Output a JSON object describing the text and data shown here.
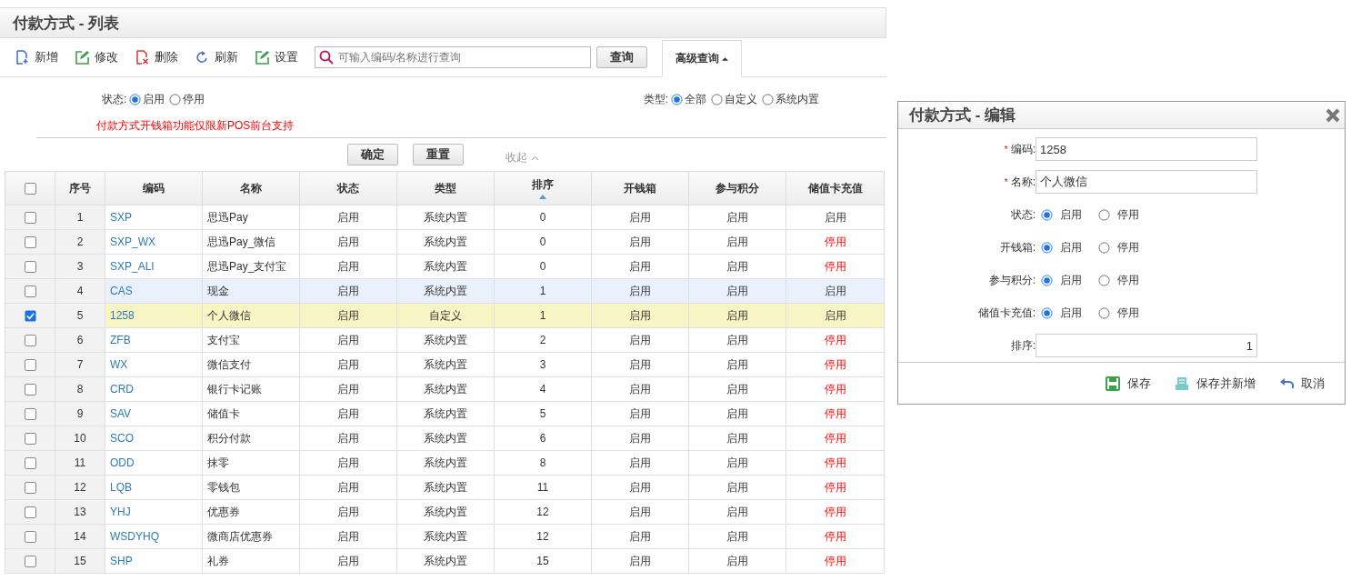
{
  "page": {
    "title": "付款方式 - 列表"
  },
  "toolbar": [
    {
      "kind": "add",
      "label": "新增"
    },
    {
      "kind": "edit",
      "label": "修改"
    },
    {
      "kind": "delete",
      "label": "删除"
    },
    {
      "kind": "refresh",
      "label": "刷新"
    },
    {
      "kind": "settings",
      "label": "设置"
    }
  ],
  "search": {
    "placeholder": "可输入编码/名称进行查询",
    "button": "查询",
    "advanced": "高级查询",
    "advanced_expanded": true
  },
  "filters": {
    "status": {
      "label": "状态:",
      "options": [
        {
          "label": "启用",
          "selected": true
        },
        {
          "label": "停用",
          "selected": false
        }
      ]
    },
    "type": {
      "label": "类型:",
      "options": [
        {
          "label": "全部",
          "selected": true
        },
        {
          "label": "自定义",
          "selected": false
        },
        {
          "label": "系统内置",
          "selected": false
        }
      ]
    },
    "notice": "付款方式开钱箱功能仅限新POS前台支持",
    "confirm": "确定",
    "reset": "重置",
    "collapse": "收起"
  },
  "table": {
    "all_checked": false,
    "columns": [
      {
        "label": "序号"
      },
      {
        "label": "编码"
      },
      {
        "label": "名称"
      },
      {
        "label": "状态"
      },
      {
        "label": "类型"
      },
      {
        "label": "排序",
        "sorted_ascending": true
      },
      {
        "label": "开钱箱"
      },
      {
        "label": "参与积分"
      },
      {
        "label": "储值卡充值"
      }
    ],
    "rows": [
      {
        "checked": false,
        "hovered": false,
        "no": "1",
        "code": "SXP",
        "name": "思迅Pay",
        "status": "启用",
        "type": "系统内置",
        "order": "0",
        "drawer": "启用",
        "points": "启用",
        "recharge": "启用",
        "recharge_on": true
      },
      {
        "checked": false,
        "hovered": false,
        "no": "2",
        "code": "SXP_WX",
        "name": "思迅Pay_微信",
        "status": "启用",
        "type": "系统内置",
        "order": "0",
        "drawer": "启用",
        "points": "启用",
        "recharge": "停用",
        "recharge_on": false
      },
      {
        "checked": false,
        "hovered": false,
        "no": "3",
        "code": "SXP_ALI",
        "name": "思迅Pay_支付宝",
        "status": "启用",
        "type": "系统内置",
        "order": "0",
        "drawer": "启用",
        "points": "启用",
        "recharge": "停用",
        "recharge_on": false
      },
      {
        "checked": false,
        "hovered": true,
        "no": "4",
        "code": "CAS",
        "name": "现金",
        "status": "启用",
        "type": "系统内置",
        "order": "1",
        "drawer": "启用",
        "points": "启用",
        "recharge": "启用",
        "recharge_on": true
      },
      {
        "checked": true,
        "hovered": false,
        "no": "5",
        "code": "1258",
        "name": "个人微信",
        "status": "启用",
        "type": "自定义",
        "order": "1",
        "drawer": "启用",
        "points": "启用",
        "recharge": "启用",
        "recharge_on": true
      },
      {
        "checked": false,
        "hovered": false,
        "no": "6",
        "code": "ZFB",
        "name": "支付宝",
        "status": "启用",
        "type": "系统内置",
        "order": "2",
        "drawer": "启用",
        "points": "启用",
        "recharge": "停用",
        "recharge_on": false
      },
      {
        "checked": false,
        "hovered": false,
        "no": "7",
        "code": "WX",
        "name": "微信支付",
        "status": "启用",
        "type": "系统内置",
        "order": "3",
        "drawer": "启用",
        "points": "启用",
        "recharge": "停用",
        "recharge_on": false
      },
      {
        "checked": false,
        "hovered": false,
        "no": "8",
        "code": "CRD",
        "name": "银行卡记账",
        "status": "启用",
        "type": "系统内置",
        "order": "4",
        "drawer": "启用",
        "points": "启用",
        "recharge": "停用",
        "recharge_on": false
      },
      {
        "checked": false,
        "hovered": false,
        "no": "9",
        "code": "SAV",
        "name": "储值卡",
        "status": "启用",
        "type": "系统内置",
        "order": "5",
        "drawer": "启用",
        "points": "启用",
        "recharge": "停用",
        "recharge_on": false
      },
      {
        "checked": false,
        "hovered": false,
        "no": "10",
        "code": "SCO",
        "name": "积分付款",
        "status": "启用",
        "type": "系统内置",
        "order": "6",
        "drawer": "启用",
        "points": "启用",
        "recharge": "停用",
        "recharge_on": false
      },
      {
        "checked": false,
        "hovered": false,
        "no": "11",
        "code": "ODD",
        "name": "抹零",
        "status": "启用",
        "type": "系统内置",
        "order": "8",
        "drawer": "启用",
        "points": "启用",
        "recharge": "停用",
        "recharge_on": false
      },
      {
        "checked": false,
        "hovered": false,
        "no": "12",
        "code": "LQB",
        "name": "零钱包",
        "status": "启用",
        "type": "系统内置",
        "order": "11",
        "drawer": "启用",
        "points": "启用",
        "recharge": "停用",
        "recharge_on": false
      },
      {
        "checked": false,
        "hovered": false,
        "no": "13",
        "code": "YHJ",
        "name": "优惠券",
        "status": "启用",
        "type": "系统内置",
        "order": "12",
        "drawer": "启用",
        "points": "启用",
        "recharge": "停用",
        "recharge_on": false
      },
      {
        "checked": false,
        "hovered": false,
        "no": "14",
        "code": "WSDYHQ",
        "name": "微商店优惠券",
        "status": "启用",
        "type": "系统内置",
        "order": "12",
        "drawer": "启用",
        "points": "启用",
        "recharge": "停用",
        "recharge_on": false
      },
      {
        "checked": false,
        "hovered": false,
        "no": "15",
        "code": "SHP",
        "name": "礼券",
        "status": "启用",
        "type": "系统内置",
        "order": "15",
        "drawer": "启用",
        "points": "启用",
        "recharge": "停用",
        "recharge_on": false
      }
    ]
  },
  "dialog": {
    "title": "付款方式 - 编辑",
    "fields": [
      {
        "kind": "text",
        "required_mark": "*",
        "label": "编码:",
        "value": "1258"
      },
      {
        "kind": "text",
        "required_mark": "*",
        "label": "名称:",
        "value": "个人微信"
      },
      {
        "kind": "radio",
        "label": "状态:",
        "options": [
          {
            "label": "启用",
            "selected": true
          },
          {
            "label": "停用",
            "selected": false
          }
        ]
      },
      {
        "kind": "radio",
        "label": "开钱箱:",
        "options": [
          {
            "label": "启用",
            "selected": true
          },
          {
            "label": "停用",
            "selected": false
          }
        ]
      },
      {
        "kind": "radio",
        "label": "参与积分:",
        "options": [
          {
            "label": "启用",
            "selected": true
          },
          {
            "label": "停用",
            "selected": false
          }
        ]
      },
      {
        "kind": "radio",
        "label": "储值卡充值:",
        "options": [
          {
            "label": "启用",
            "selected": true
          },
          {
            "label": "停用",
            "selected": false
          }
        ]
      },
      {
        "kind": "number",
        "label": "排序:",
        "value": "1"
      }
    ],
    "buttons": [
      {
        "kind": "save",
        "label": "保存"
      },
      {
        "kind": "save_new",
        "label": "保存并新增"
      },
      {
        "kind": "cancel",
        "label": "取消"
      }
    ]
  }
}
